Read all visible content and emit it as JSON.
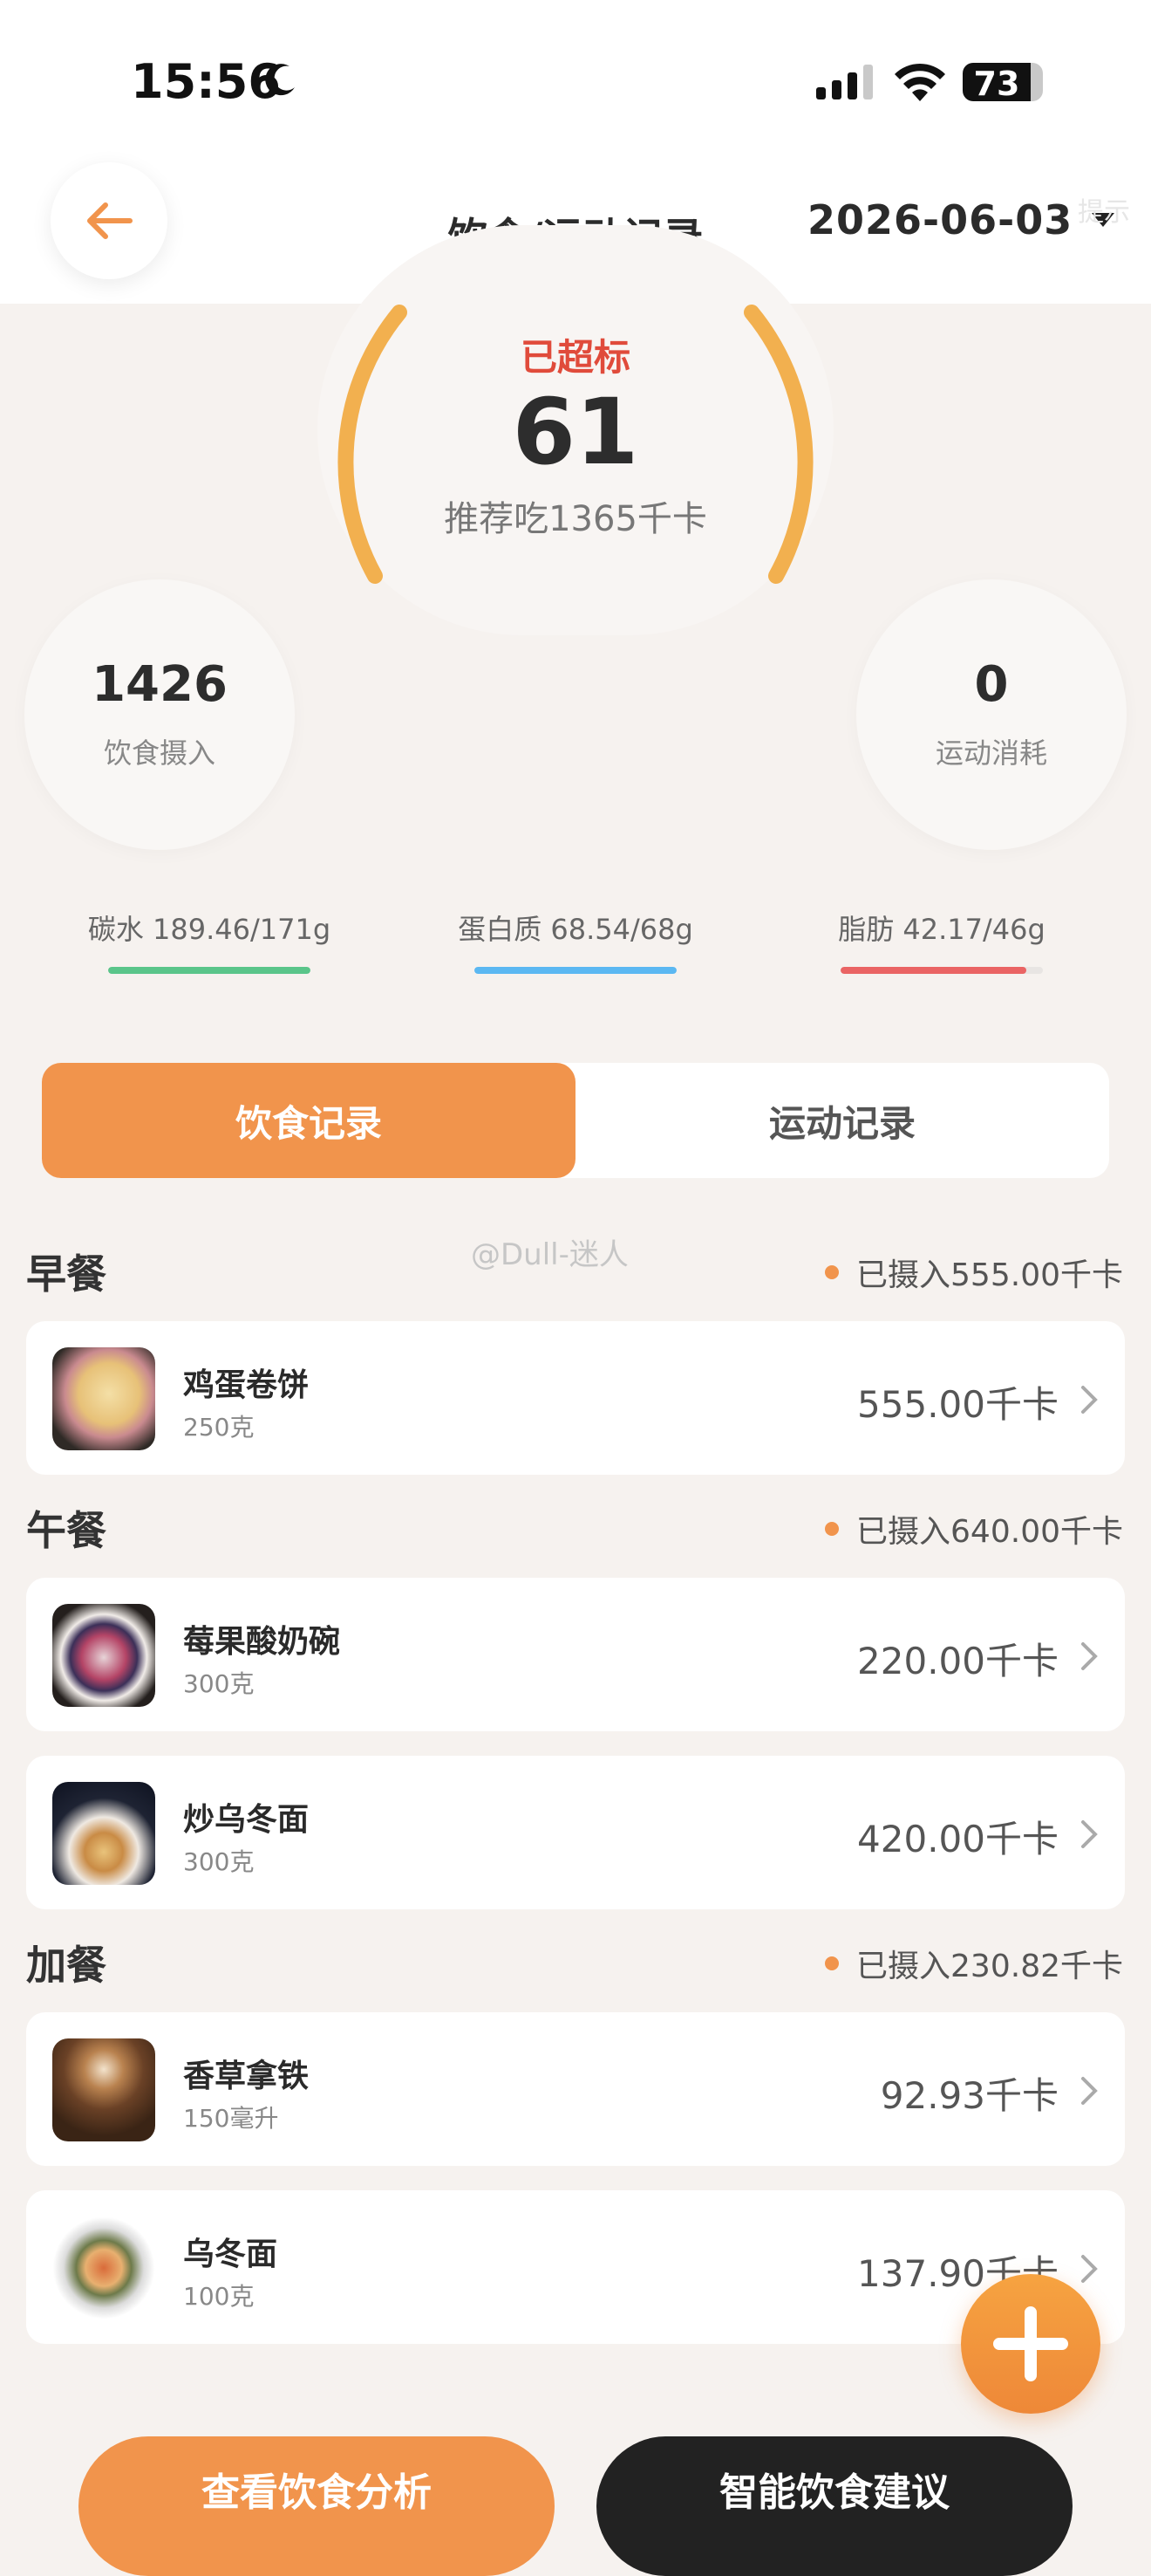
{
  "status_bar": {
    "time": "15:56",
    "battery": "73"
  },
  "header": {
    "title": "饮食/运动记录",
    "date": "2026-06-03",
    "ghost_text": "提示"
  },
  "gauge": {
    "status": "已超标",
    "value": "61",
    "recommendation": "推荐吃1365千卡"
  },
  "stats": {
    "intake": {
      "value": "1426",
      "label": "饮食摄入"
    },
    "burn": {
      "value": "0",
      "label": "运动消耗"
    }
  },
  "macros": [
    {
      "label": "碳水 189.46/171g",
      "color": "#5ac58a",
      "fraction": 1.0
    },
    {
      "label": "蛋白质 68.54/68g",
      "color": "#5bb8f2",
      "fraction": 1.0
    },
    {
      "label": "脂肪 42.17/46g",
      "color": "#ea6464",
      "fraction": 0.917
    }
  ],
  "tabs": {
    "diet": "饮食记录",
    "exercise": "运动记录"
  },
  "watermark": "@Dull-迷人",
  "sections": {
    "breakfast": {
      "title": "早餐",
      "summary": "已摄入555.00千卡"
    },
    "lunch": {
      "title": "午餐",
      "summary": "已摄入640.00千卡"
    },
    "snack": {
      "title": "加餐",
      "summary": "已摄入230.82千卡"
    }
  },
  "items": [
    {
      "name": "鸡蛋卷饼",
      "amount": "250克",
      "kcal": "555.00千卡"
    },
    {
      "name": "莓果酸奶碗",
      "amount": "300克",
      "kcal": "220.00千卡"
    },
    {
      "name": "炒乌冬面",
      "amount": "300克",
      "kcal": "420.00千卡"
    },
    {
      "name": "香草拿铁",
      "amount": "150毫升",
      "kcal": "92.93千卡"
    },
    {
      "name": "乌冬面",
      "amount": "100克",
      "kcal": "137.90千卡"
    }
  ],
  "buttons": {
    "analysis": "查看饮食分析",
    "advice": "智能饮食建议"
  },
  "colors": {
    "accent": "#f1944c",
    "gauge": "#f2b04f",
    "warning": "#e04b3b"
  }
}
